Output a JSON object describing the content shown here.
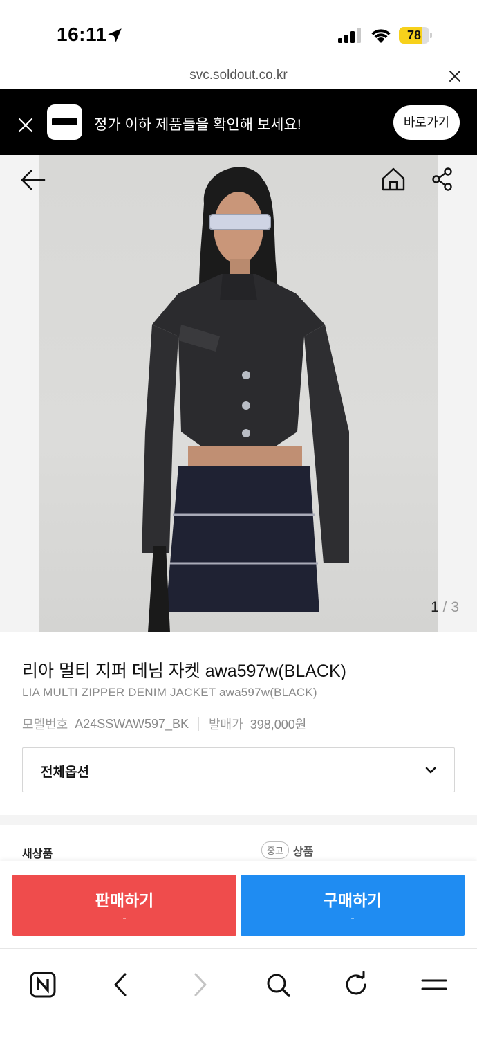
{
  "status_bar": {
    "time": "16:11",
    "battery": "78",
    "battery_level": 0.78,
    "battery_color": "#f7d11b"
  },
  "url_bar": {
    "domain": "svc.soldout.co.kr"
  },
  "app_banner": {
    "message": "정가 이하 제품들을 확인해 보세요!",
    "cta_label": "바로가기",
    "background": "#000000"
  },
  "hero": {
    "current_page": "1",
    "separator": " / ",
    "total_pages": "3"
  },
  "product": {
    "title_ko": "리아 멀티 지퍼 데님 자켓 awa597w(BLACK)",
    "title_en": "LIA MULTI ZIPPER DENIM JACKET awa597w(BLACK)",
    "model_label": "모델번호",
    "model_value": "A24SSWAW597_BK",
    "release_label": "발매가",
    "release_value": "398,000원",
    "option_label": "전체옵션"
  },
  "price_columns": {
    "new_label": "새상품",
    "used_badge": "중고",
    "used_label": "상품"
  },
  "actions": {
    "sell_label": "판매하기",
    "sell_sub": "-",
    "sell_color": "#ef4c4c",
    "buy_label": "구매하기",
    "buy_sub": "-",
    "buy_color": "#1f8cf2"
  },
  "toolbar": {
    "icons": [
      "naver-n-icon",
      "back-icon",
      "forward-icon",
      "search-icon",
      "refresh-icon",
      "menu-icon"
    ]
  }
}
